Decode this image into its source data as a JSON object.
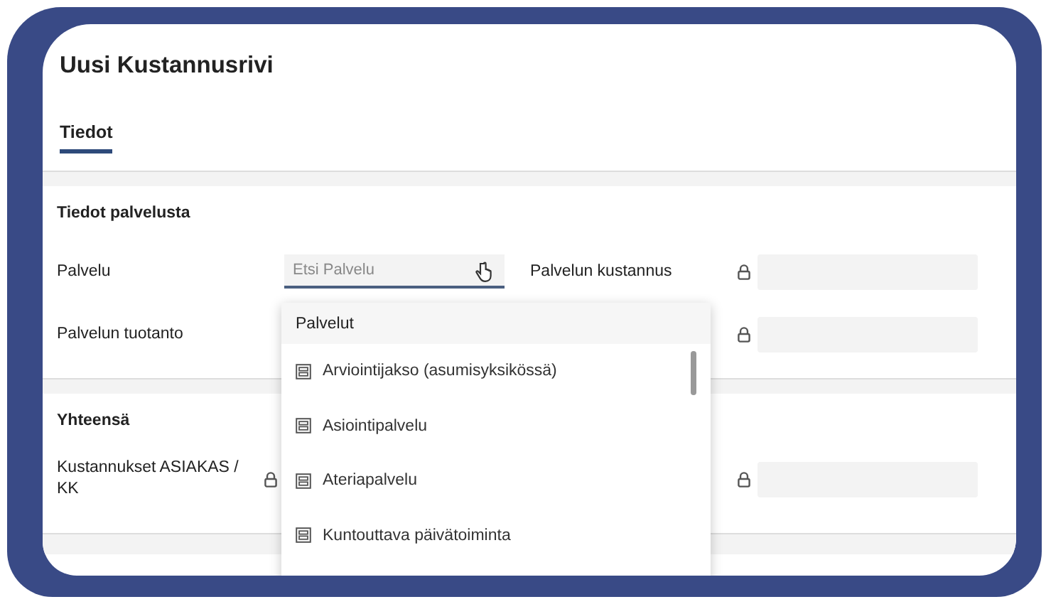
{
  "dialog": {
    "title": "Uusi Kustannusrivi"
  },
  "tabs": [
    {
      "label": "Tiedot",
      "selected": true
    }
  ],
  "sections": [
    {
      "heading": "Tiedot palvelusta",
      "rows": [
        {
          "cells": [
            {
              "kind": "search",
              "label": "Palvelu",
              "placeholder": "Etsi Palvelu"
            },
            {
              "kind": "locked",
              "label": "Palvelun kustannus"
            }
          ]
        },
        {
          "cells": [
            {
              "kind": "plain",
              "label": "Palvelun tuotanto"
            },
            {
              "kind": "locked"
            }
          ]
        }
      ]
    },
    {
      "heading": "Yhteensä",
      "rows": [
        {
          "cells": [
            {
              "kind": "lockonly",
              "label": "Kustannukset ASIAKAS / KK"
            },
            {
              "kind": "locked"
            }
          ]
        }
      ]
    }
  ],
  "dropdown": {
    "header": "Palvelut",
    "items": [
      "Arviointijakso (asumisyksikössä)",
      "Asiointipalvelu",
      "Ateriapalvelu",
      "Kuntouttava päivätoiminta"
    ]
  }
}
